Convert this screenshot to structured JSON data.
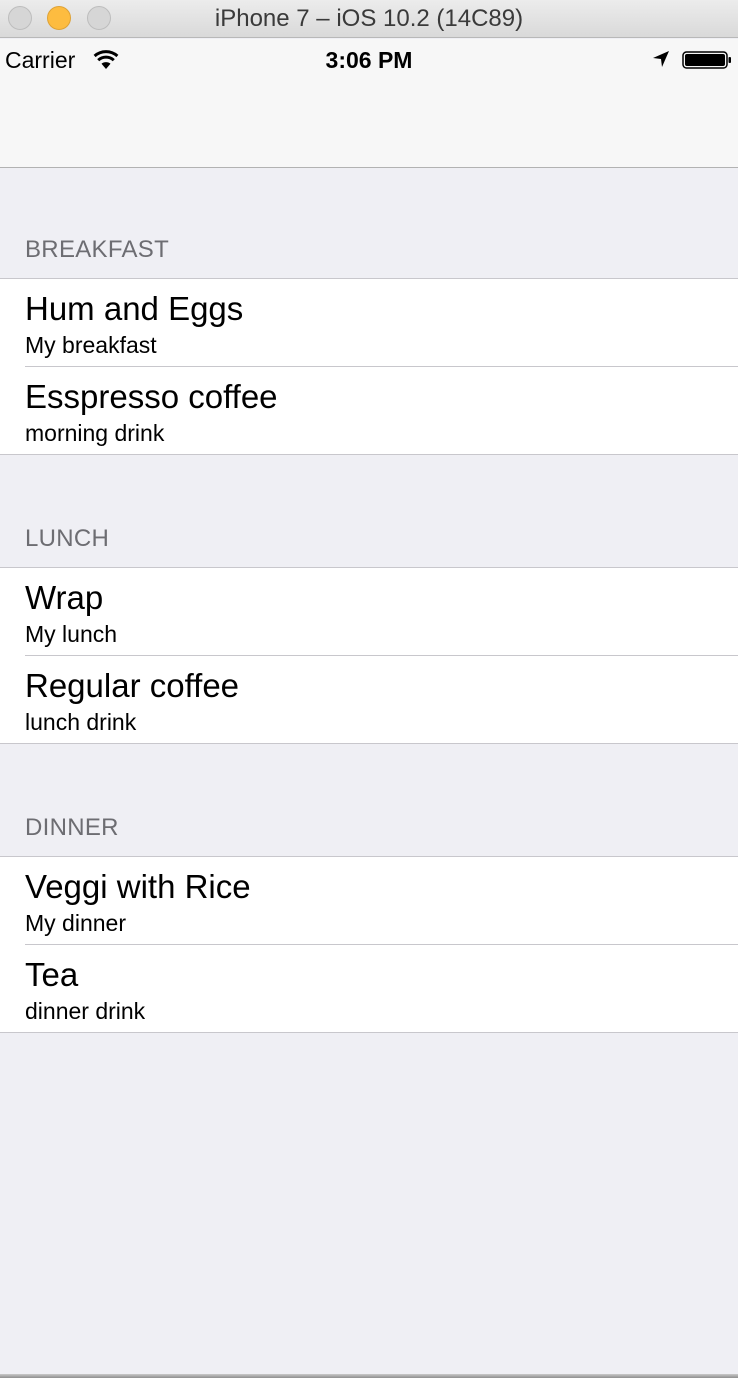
{
  "window": {
    "title": "iPhone 7 – iOS 10.2 (14C89)"
  },
  "status_bar": {
    "carrier": "Carrier",
    "time": "3:06 PM",
    "icons": [
      "wifi-icon",
      "location-arrow-icon",
      "battery-icon"
    ]
  },
  "sections": [
    {
      "header": "BREAKFAST",
      "rows": [
        {
          "title": "Hum and Eggs",
          "subtitle": "My breakfast"
        },
        {
          "title": "Esspresso coffee",
          "subtitle": "morning drink"
        }
      ]
    },
    {
      "header": "LUNCH",
      "rows": [
        {
          "title": "Wrap",
          "subtitle": "My lunch"
        },
        {
          "title": "Regular coffee",
          "subtitle": "lunch drink"
        }
      ]
    },
    {
      "header": "DINNER",
      "rows": [
        {
          "title": "Veggi with Rice",
          "subtitle": "My dinner"
        },
        {
          "title": "Tea",
          "subtitle": "dinner drink"
        }
      ]
    }
  ],
  "colors": {
    "table_background": "#efeff4",
    "separator": "#c8c7cc",
    "section_header_text": "#6d6d72",
    "minimize_button": "#fdbc40"
  }
}
